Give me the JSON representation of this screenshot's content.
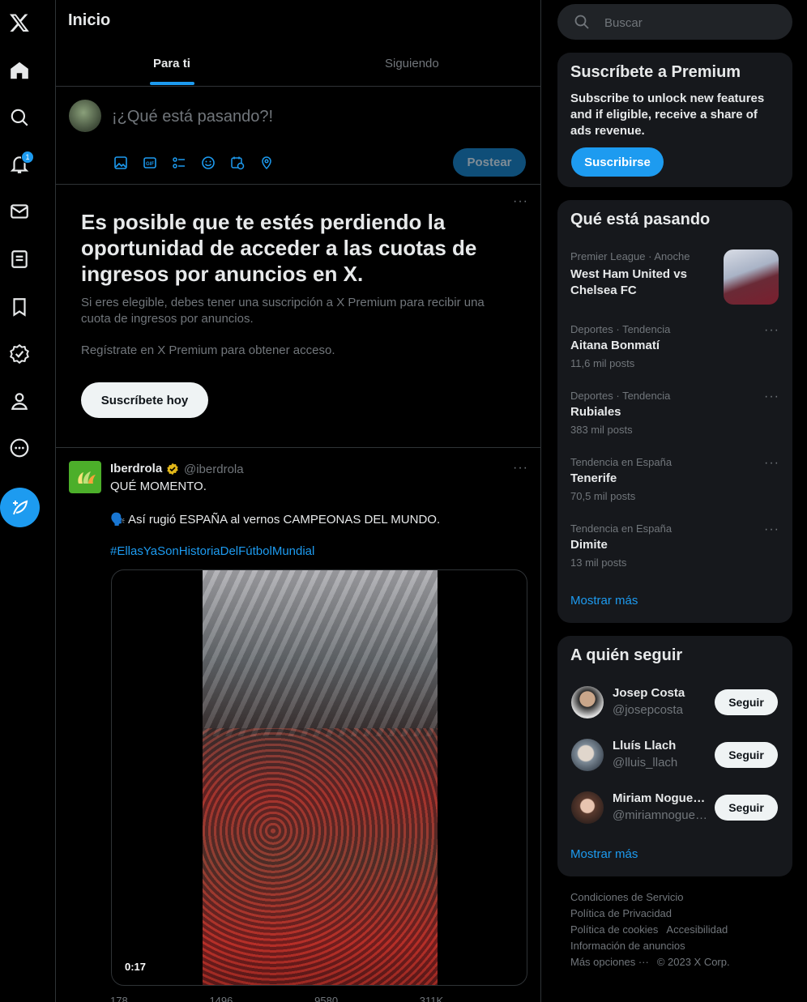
{
  "nav": {
    "notifications_badge": "1"
  },
  "main": {
    "title": "Inicio",
    "tabs": [
      {
        "label": "Para ti"
      },
      {
        "label": "Siguiendo"
      }
    ],
    "composer": {
      "placeholder": "¡¿Qué está pasando?!",
      "post_label": "Postear"
    },
    "promo": {
      "heading": "Es posible que te estés perdiendo la oportunidad de acceder a las cuotas de ingresos por anuncios en X.",
      "body": "Si eres elegible, debes tener una suscripción a X Premium para recibir una cuota de ingresos por anuncios.",
      "cta_text": "Regístrate en X Premium para obtener acceso.",
      "button": "Suscríbete hoy"
    },
    "tweet": {
      "name": "Iberdrola",
      "handle": "@iberdrola",
      "line1": "QUÉ MOMENTO.",
      "line2": "🗣️ Así rugió ESPAÑA al vernos CAMPEONAS DEL MUNDO.",
      "hashtag": "#EllasYaSonHistoriaDelFútbolMundial",
      "video_time": "0:17",
      "actions": [
        "178",
        "1496",
        "9580",
        "311K",
        ""
      ]
    }
  },
  "search": {
    "placeholder": "Buscar"
  },
  "premium": {
    "title": "Suscríbete a Premium",
    "body": "Subscribe to unlock new features and if eligible, receive a share of ads revenue.",
    "button": "Suscribirse"
  },
  "trends": {
    "title": "Qué está pasando",
    "items": [
      {
        "meta": "Premier League · Anoche",
        "name": "West Ham United vs Chelsea FC",
        "count": ""
      },
      {
        "meta": "Deportes · Tendencia",
        "name": "Aitana Bonmatí",
        "count": "11,6 mil posts"
      },
      {
        "meta": "Deportes · Tendencia",
        "name": "Rubiales",
        "count": "383 mil posts"
      },
      {
        "meta": "Tendencia en España",
        "name": "Tenerife",
        "count": "70,5 mil posts"
      },
      {
        "meta": "Tendencia en España",
        "name": "Dimite",
        "count": "13 mil posts"
      }
    ],
    "show_more": "Mostrar más"
  },
  "follow": {
    "title": "A quién seguir",
    "items": [
      {
        "name": "Josep Costa",
        "handle": "@josepcosta",
        "button": "Seguir"
      },
      {
        "name": "Lluís Llach",
        "handle": "@lluis_llach",
        "button": "Seguir"
      },
      {
        "name": "Miriam Nogueras",
        "handle": "@miriamnogueras",
        "button": "Seguir"
      }
    ],
    "show_more": "Mostrar más"
  },
  "footer": {
    "links": [
      "Condiciones de Servicio",
      "Política de Privacidad",
      "Política de cookies",
      "Accesibilidad",
      "Información de anuncios",
      "Más opciones ···",
      "© 2023 X Corp."
    ]
  },
  "colors": {
    "accent": "#1d9bf0",
    "background": "#000000",
    "card": "#16181c",
    "muted": "#71767b"
  }
}
